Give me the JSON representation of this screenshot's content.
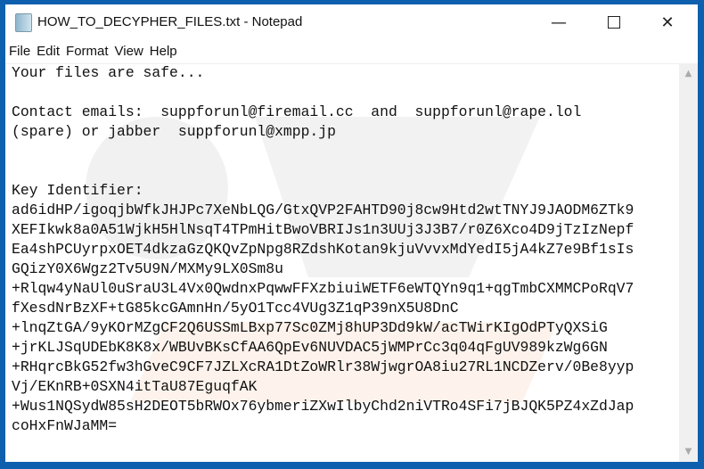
{
  "window": {
    "title": "HOW_TO_DECYPHER_FILES.txt - Notepad",
    "accent": "#0e5fae"
  },
  "menu": [
    "File",
    "Edit",
    "Format",
    "View",
    "Help"
  ],
  "content": {
    "lines": [
      "Your files are safe...",
      "",
      "Contact emails:  suppforunl@firemail.cc  and  suppforunl@rape.lol",
      "(spare) or jabber  suppforunl@xmpp.jp",
      "",
      "",
      "Key Identifier:",
      "ad6idHP/igoqjbWfkJHJPc7XeNbLQG/GtxQVP2FAHTD90j8cw9Htd2wtTNYJ9JAODM6ZTk9",
      "XEFIkwk8a0A51WjkH5HlNsqT4TPmHitBwoVBRIJs1n3UUj3J3B7/r0Z6Xco4D9jTzIzNepf",
      "Ea4shPCUyrpxOET4dkzaGzQKQvZpNpg8RZdshKotan9kjuVvvxMdYedI5jA4kZ7e9Bf1sIs",
      "GQizY0X6Wgz2Tv5U9N/MXMy9LX0Sm8u",
      "+Rlqw4yNaUl0uSraU3L4Vx0QwdnxPqwwFFXzbiuiWETF6eWTQYn9q1+qgTmbCXMMCPoRqV7",
      "fXesdNrBzXF+tG85kcGAmnHn/5yO1Tcc4VUg3Z1qP39nX5U8DnC",
      "+lnqZtGA/9yKOrMZgCF2Q6USSmLBxp77Sc0ZMj8hUP3Dd9kW/acTWirKIgOdPTyQXSiG",
      "+jrKLJSqUDEbK8K8x/WBUvBKsCfAA6QpEv6NUVDAC5jWMPrCc3q04qFgUV989kzWg6GN",
      "+RHqrcBkG52fw3hGveC9CF7JZLXcRA1DtZoWRlr38WjwgrOA8iu27RL1NCDZerv/0Be8yyp",
      "Vj/EKnRB+0SXN4itTaU87EguqfAK",
      "+Wus1NQSydW85sH2DEOT5bRWOx76ybmeriZXwIlbyChd2niVTRo4SFi7jBJQK5PZ4xZdJap",
      "coHxFnWJaMM="
    ]
  }
}
